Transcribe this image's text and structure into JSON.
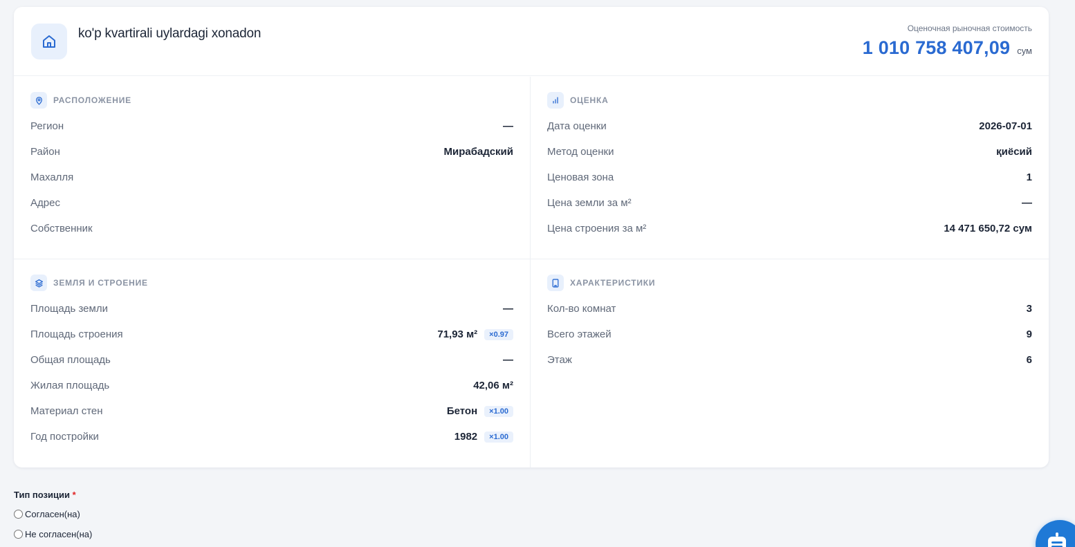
{
  "header": {
    "title": "ko'p kvartirali uylardagi xonadon",
    "price_label": "Оценочная рыночная стоимость",
    "price_value": "1 010 758 407,09",
    "price_unit": "сум",
    "icon": "home-icon"
  },
  "location": {
    "title": "РАСПОЛОЖЕНИЕ",
    "icon": "map-pin-icon",
    "rows": [
      {
        "label": "Регион",
        "value": "—"
      },
      {
        "label": "Район",
        "value": "Мирабадский"
      },
      {
        "label": "Махалля",
        "value": ""
      },
      {
        "label": "Адрес",
        "value": ""
      },
      {
        "label": "Собственник",
        "value": ""
      }
    ]
  },
  "evaluation": {
    "title": "ОЦЕНКА",
    "icon": "bar-chart-icon",
    "rows": [
      {
        "label": "Дата оценки",
        "value": "2026-07-01"
      },
      {
        "label": "Метод оценки",
        "value": "қиёсий"
      },
      {
        "label": "Ценовая зона",
        "value": "1"
      },
      {
        "label": "Цена земли за м²",
        "value": "—"
      },
      {
        "label": "Цена строения за м²",
        "value": "14 471 650,72 сум"
      }
    ]
  },
  "land": {
    "title": "ЗЕМЛЯ И СТРОЕНИЕ",
    "icon": "layers-icon",
    "rows": [
      {
        "label": "Площадь земли",
        "value": "—",
        "badge": ""
      },
      {
        "label": "Площадь строения",
        "value": "71,93 м²",
        "badge": "×0.97"
      },
      {
        "label": "Общая площадь",
        "value": "—",
        "badge": ""
      },
      {
        "label": "Жилая площадь",
        "value": "42,06 м²",
        "badge": ""
      },
      {
        "label": "Материал стен",
        "value": "Бетон",
        "badge": "×1.00"
      },
      {
        "label": "Год постройки",
        "value": "1982",
        "badge": "×1.00"
      }
    ]
  },
  "characteristics": {
    "title": "ХАРАКТЕРИСТИКИ",
    "icon": "building-icon",
    "rows": [
      {
        "label": "Кол-во комнат",
        "value": "3"
      },
      {
        "label": "Всего этажей",
        "value": "9"
      },
      {
        "label": "Этаж",
        "value": "6"
      }
    ]
  },
  "form": {
    "label": "Тип позиции",
    "required_mark": "*",
    "options": [
      "Согласен(на)",
      "Не согласен(на)"
    ]
  },
  "fab": {
    "icon": "chatbot-icon"
  },
  "colors": {
    "accent": "#2a6ad1",
    "badge_bg": "#eaf1fc",
    "icon_bg": "#e8f0fc",
    "fab": "#1f79d6"
  }
}
